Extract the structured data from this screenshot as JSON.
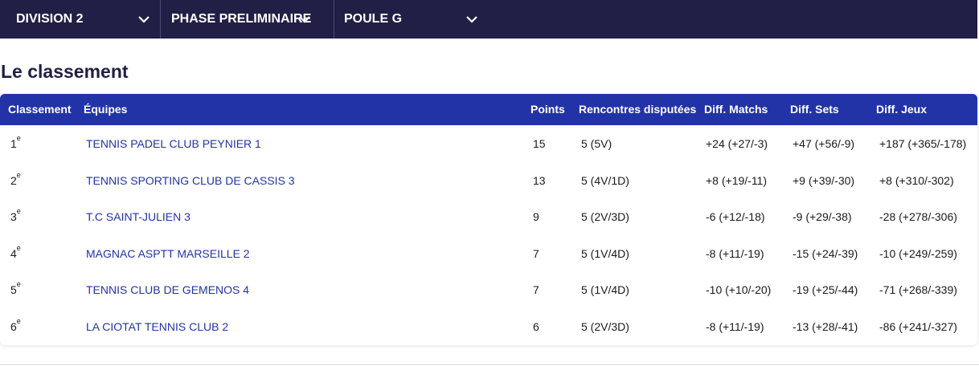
{
  "filters": [
    {
      "label": "DIVISION 2"
    },
    {
      "label": "PHASE PRELIMINAIRE"
    },
    {
      "label": "POULE G"
    }
  ],
  "page_title": "Le classement",
  "table": {
    "headers": {
      "rank": "Classement",
      "team": "Équipes",
      "points": "Points",
      "played": "Rencontres disputées",
      "diff_matches": "Diff. Matchs",
      "diff_sets": "Diff. Sets",
      "diff_games": "Diff. Jeux"
    },
    "rows": [
      {
        "rank": "1",
        "suffix": "e",
        "team": "TENNIS PADEL CLUB PEYNIER 1",
        "points": "15",
        "played": "5 (5V)",
        "diff_matches": "+24 (+27/-3)",
        "diff_sets": "+47 (+56/-9)",
        "diff_games": "+187 (+365/-178)"
      },
      {
        "rank": "2",
        "suffix": "e",
        "team": "TENNIS SPORTING CLUB DE CASSIS 3",
        "points": "13",
        "played": "5 (4V/1D)",
        "diff_matches": "+8 (+19/-11)",
        "diff_sets": "+9 (+39/-30)",
        "diff_games": "+8 (+310/-302)"
      },
      {
        "rank": "3",
        "suffix": "e",
        "team": "T.C SAINT-JULIEN 3",
        "points": "9",
        "played": "5 (2V/3D)",
        "diff_matches": "-6 (+12/-18)",
        "diff_sets": "-9 (+29/-38)",
        "diff_games": "-28 (+278/-306)"
      },
      {
        "rank": "4",
        "suffix": "e",
        "team": "MAGNAC ASPTT MARSEILLE 2",
        "points": "7",
        "played": "5 (1V/4D)",
        "diff_matches": "-8 (+11/-19)",
        "diff_sets": "-15 (+24/-39)",
        "diff_games": "-10 (+249/-259)"
      },
      {
        "rank": "5",
        "suffix": "e",
        "team": "TENNIS CLUB DE GEMENOS 4",
        "points": "7",
        "played": "5 (1V/4D)",
        "diff_matches": "-10 (+10/-20)",
        "diff_sets": "-19 (+25/-44)",
        "diff_games": "-71 (+268/-339)"
      },
      {
        "rank": "6",
        "suffix": "e",
        "team": "LA CIOTAT TENNIS CLUB 2",
        "points": "6",
        "played": "5 (2V/3D)",
        "diff_matches": "-8 (+11/-19)",
        "diff_sets": "-13 (+28/-41)",
        "diff_games": "-86 (+241/-327)"
      }
    ]
  },
  "colors": {
    "topbar_bg": "#211f45",
    "header_bg": "#2233a8",
    "link": "#2233a8"
  }
}
